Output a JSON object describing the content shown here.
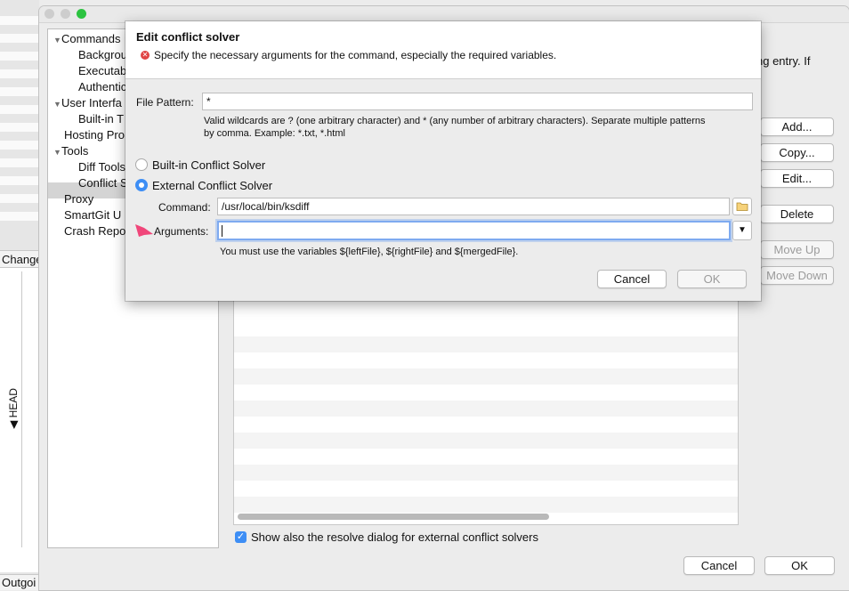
{
  "background_app": {
    "changes_label": "Change",
    "outgoing_label": "Outgoi",
    "branch_label": "HEAD"
  },
  "prefs": {
    "tree": [
      {
        "label": "Commands",
        "expanded": true,
        "level": 0
      },
      {
        "label": "Backgrou",
        "level": 1
      },
      {
        "label": "Executab",
        "level": 1
      },
      {
        "label": "Authentic",
        "level": 1
      },
      {
        "label": "User Interfa",
        "expanded": true,
        "level": 0
      },
      {
        "label": "Built-in T",
        "level": 1
      },
      {
        "label": "Hosting Pro",
        "level": 0
      },
      {
        "label": "Tools",
        "expanded": true,
        "level": 0
      },
      {
        "label": "Diff Tools",
        "level": 1
      },
      {
        "label": "Conflict S",
        "level": 1,
        "selected": true
      },
      {
        "label": "Proxy",
        "level": 0
      },
      {
        "label": "SmartGit U",
        "level": 0
      },
      {
        "label": "Crash Repo",
        "level": 0
      }
    ],
    "header_fragment": "ng entry. If",
    "side_buttons": {
      "add": "Add...",
      "copy": "Copy...",
      "edit": "Edit...",
      "delete": "Delete",
      "move_up": "Move Up",
      "move_down": "Move Down"
    },
    "show_resolve_label": "Show also the resolve dialog for external conflict solvers",
    "show_resolve_checked": true,
    "cancel_label": "Cancel",
    "ok_label": "OK"
  },
  "dialog": {
    "title": "Edit conflict solver",
    "error_message": "Specify the necessary arguments for the command, especially the required variables.",
    "file_pattern_label": "File Pattern:",
    "file_pattern_value": "*",
    "wildcard_hint_1": "Valid wildcards are ? (one arbitrary character) and * (any number of arbitrary characters). Separate multiple patterns",
    "wildcard_hint_2": "by comma. Example: *.txt, *.html",
    "builtin_label": "Built-in Conflict Solver",
    "external_label": "External Conflict Solver",
    "selected_solver": "external",
    "command_label": "Command:",
    "command_value": "/usr/local/bin/ksdiff",
    "arguments_label": "Arguments:",
    "arguments_value": "",
    "variables_hint": "You must use the variables ${leftFile}, ${rightFile} and ${mergedFile}.",
    "cancel_label": "Cancel",
    "ok_label": "OK"
  },
  "colors": {
    "accent": "#3d8ef5",
    "error": "#e04444",
    "annotation_arrow": "#f0467a"
  }
}
